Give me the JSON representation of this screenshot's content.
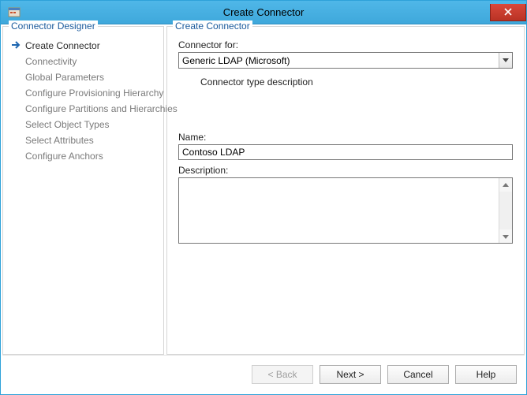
{
  "window": {
    "title": "Create Connector"
  },
  "sidebar": {
    "header": "Connector Designer",
    "items": [
      {
        "label": "Create Connector",
        "current": true
      },
      {
        "label": "Connectivity"
      },
      {
        "label": "Global Parameters"
      },
      {
        "label": "Configure Provisioning Hierarchy"
      },
      {
        "label": "Configure Partitions and Hierarchies"
      },
      {
        "label": "Select Object Types"
      },
      {
        "label": "Select Attributes"
      },
      {
        "label": "Configure Anchors"
      }
    ]
  },
  "main": {
    "header": "Create Connector",
    "connector_for_label": "Connector for:",
    "connector_for_value": "Generic LDAP (Microsoft)",
    "type_desc": "Connector type description",
    "name_label": "Name:",
    "name_value": "Contoso LDAP",
    "description_label": "Description:",
    "description_value": ""
  },
  "buttons": {
    "back": "<  Back",
    "next": "Next  >",
    "cancel": "Cancel",
    "help": "Help"
  }
}
